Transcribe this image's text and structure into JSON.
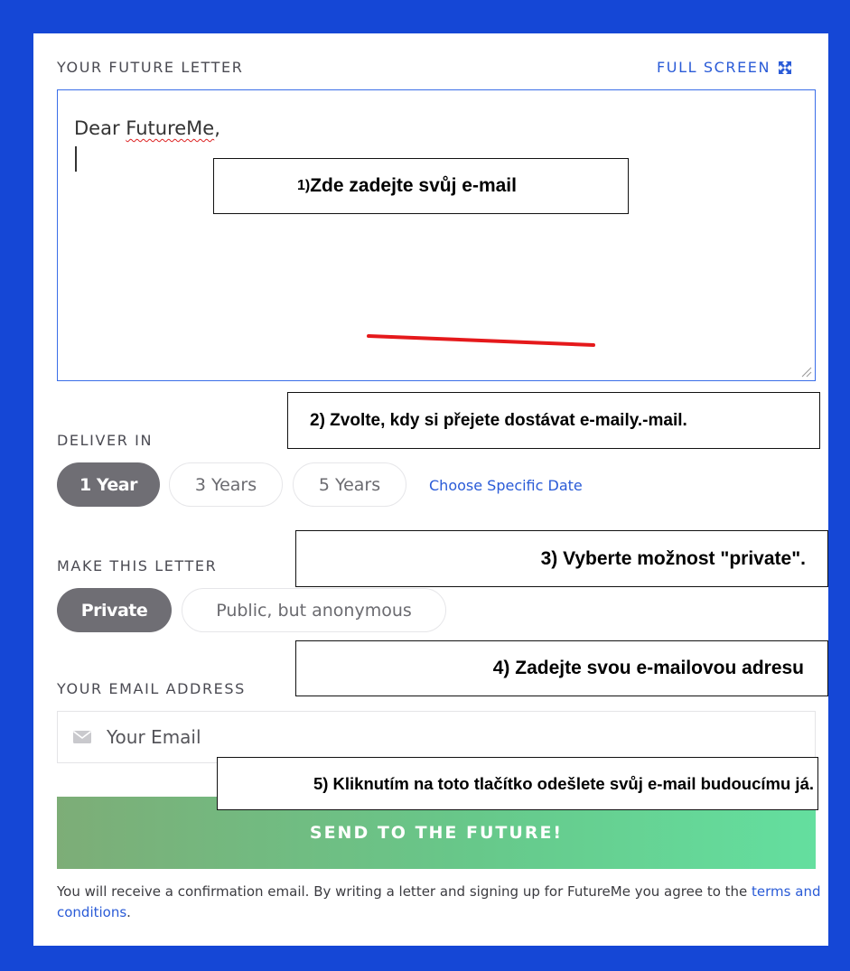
{
  "letter_section": {
    "label": "YOUR FUTURE LETTER",
    "full_screen_label": "FULL SCREEN",
    "greeting_prefix": "Dear ",
    "greeting_name": "FutureMe",
    "greeting_suffix": ","
  },
  "deliver": {
    "label": "DELIVER IN",
    "options": [
      "1 Year",
      "3 Years",
      "5 Years"
    ],
    "selected": "1 Year",
    "specific_date_link": "Choose Specific Date"
  },
  "visibility": {
    "label": "MAKE THIS LETTER",
    "options": [
      "Private",
      "Public, but anonymous"
    ],
    "selected": "Private"
  },
  "email": {
    "label": "YOUR EMAIL ADDRESS",
    "placeholder": "Your Email",
    "value": ""
  },
  "send_button": {
    "label": "SEND TO THE FUTURE!"
  },
  "footer": {
    "text": "You will receive a confirmation email. By writing a letter and signing up for FutureMe you agree to the ",
    "link": "terms and conditions",
    "end": "."
  },
  "annotations": {
    "step1_number": "1)",
    "step1_text": "Zde zadejte svůj e-mail",
    "step2": "2) Zvolte, kdy si přejete dostávat e-maily.-mail.",
    "step3": "3) Vyberte možnost \"private\".",
    "step4": "4) Zadejte svou e-mailovou adresu",
    "step5": "5) Kliknutím na toto tlačítko odešlete svůj e-mail budoucímu já."
  },
  "colors": {
    "frame": "#1547d6",
    "accent_blue": "#2a5bd7",
    "active_pill": "#6f6e74",
    "send_gradient_start": "#7dad77",
    "send_gradient_end": "#64df9f",
    "annotation_line": "#e5191b"
  },
  "icons": {
    "full_screen": "expand-arrows-icon",
    "email": "envelope-icon",
    "textarea_resize": "resize-grip-icon"
  }
}
